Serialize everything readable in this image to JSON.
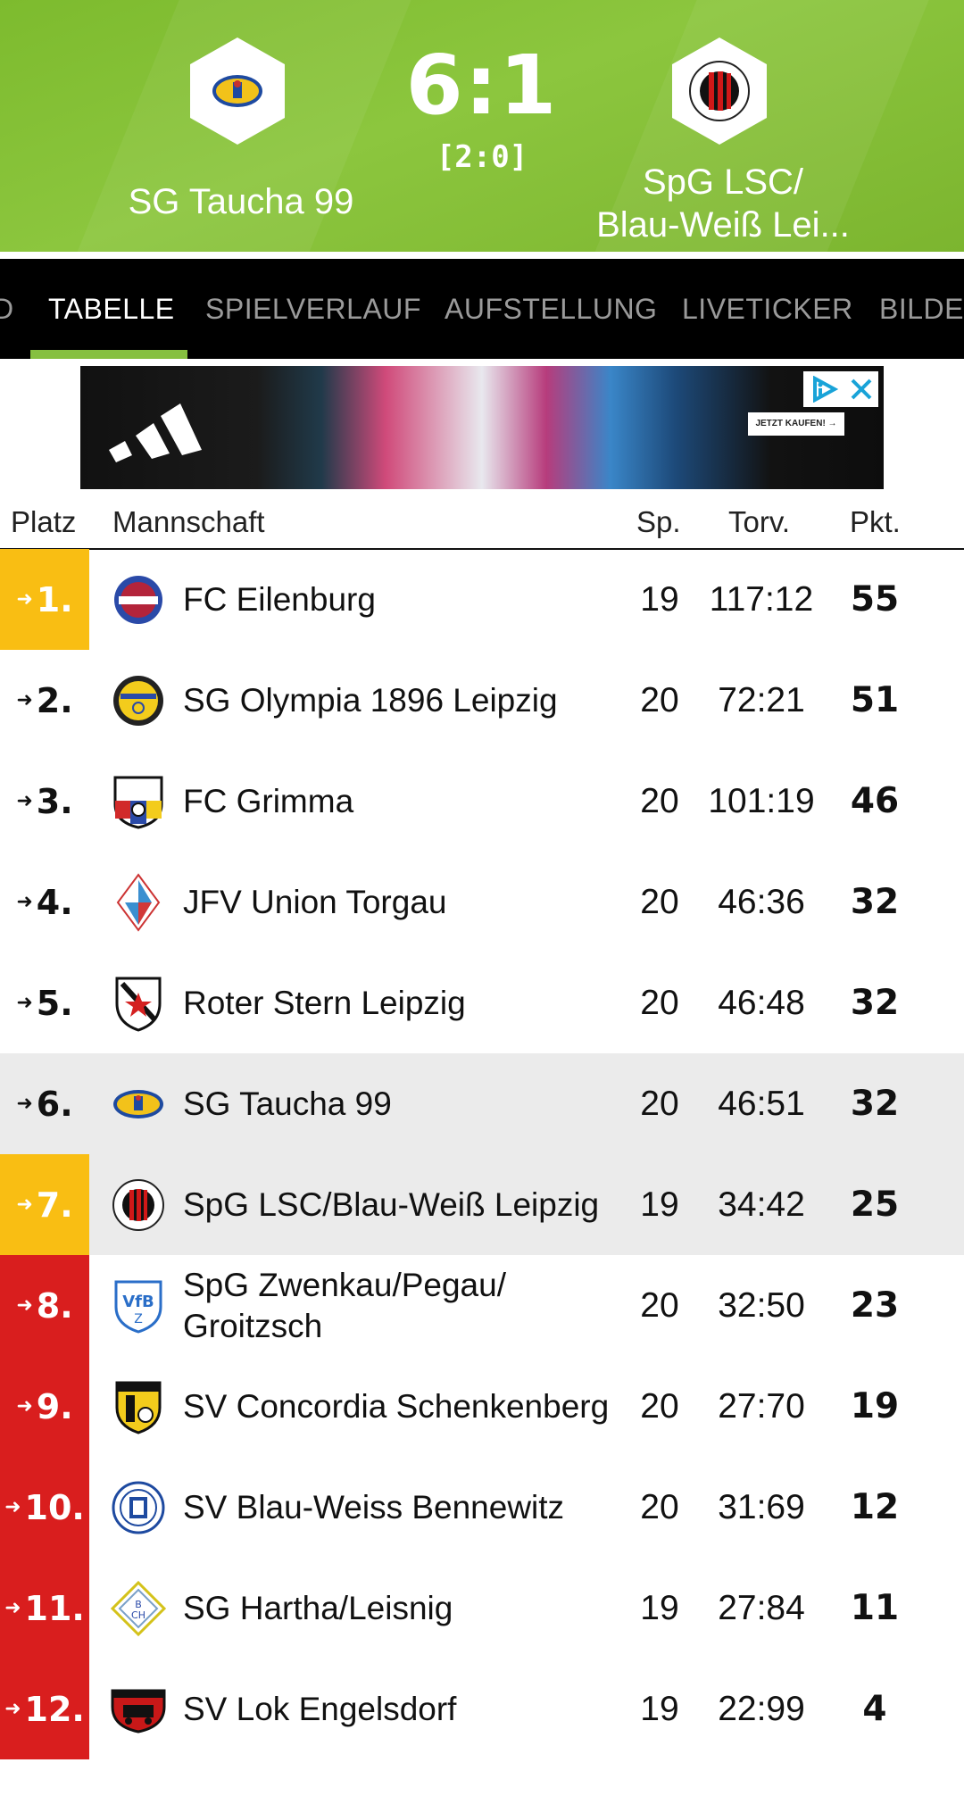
{
  "match": {
    "home_team": "SG Taucha 99",
    "away_team_line1": "SpG LSC/",
    "away_team_line2": "Blau-Weiß Lei...",
    "score": "6:1",
    "halftime": "[2:0]"
  },
  "tabs": [
    {
      "label": "D"
    },
    {
      "label": "TABELLE",
      "active": true
    },
    {
      "label": "SPIELVERLAUF"
    },
    {
      "label": "AUFSTELLUNG"
    },
    {
      "label": "LIVETICKER"
    },
    {
      "label": "BILDER"
    }
  ],
  "ad": {
    "cta": "JETZT KAUFEN! →",
    "choices_icon": "ad-choices-icon",
    "close_icon": "close-icon"
  },
  "table": {
    "headers": {
      "platz": "Platz",
      "mannschaft": "Mannschaft",
      "sp": "Sp.",
      "torv": "Torv.",
      "pkt": "Pkt."
    },
    "rows": [
      {
        "rank": "1.",
        "team": "FC Eilenburg",
        "sp": "19",
        "torv": "117:12",
        "pkt": "55",
        "zone": "yellow"
      },
      {
        "rank": "2.",
        "team": "SG Olympia 1896 Leipzig",
        "sp": "20",
        "torv": "72:21",
        "pkt": "51",
        "zone": "none"
      },
      {
        "rank": "3.",
        "team": "FC Grimma",
        "sp": "20",
        "torv": "101:19",
        "pkt": "46",
        "zone": "none"
      },
      {
        "rank": "4.",
        "team": "JFV Union Torgau",
        "sp": "20",
        "torv": "46:36",
        "pkt": "32",
        "zone": "none"
      },
      {
        "rank": "5.",
        "team": "Roter Stern Leipzig",
        "sp": "20",
        "torv": "46:48",
        "pkt": "32",
        "zone": "none"
      },
      {
        "rank": "6.",
        "team": "SG Taucha 99",
        "sp": "20",
        "torv": "46:51",
        "pkt": "32",
        "zone": "none",
        "highlight": true
      },
      {
        "rank": "7.",
        "team": "SpG LSC/Blau-Weiß Leipzig",
        "sp": "19",
        "torv": "34:42",
        "pkt": "25",
        "zone": "yellow",
        "highlight": true
      },
      {
        "rank": "8.",
        "team": "SpG Zwenkau/Pegau/ Groitzsch",
        "sp": "20",
        "torv": "32:50",
        "pkt": "23",
        "zone": "red"
      },
      {
        "rank": "9.",
        "team": "SV Concordia Schenkenberg",
        "sp": "20",
        "torv": "27:70",
        "pkt": "19",
        "zone": "red"
      },
      {
        "rank": "10.",
        "team": "SV Blau-Weiss Bennewitz",
        "sp": "20",
        "torv": "31:69",
        "pkt": "12",
        "zone": "red"
      },
      {
        "rank": "11.",
        "team": "SG Hartha/Leisnig",
        "sp": "19",
        "torv": "27:84",
        "pkt": "11",
        "zone": "red"
      },
      {
        "rank": "12.",
        "team": "SV Lok Engelsdorf",
        "sp": "19",
        "torv": "22:99",
        "pkt": "4",
        "zone": "red"
      }
    ]
  },
  "colors": {
    "header_green": "#8cc63e",
    "tab_bar": "#000000",
    "tab_accent": "#86c040",
    "promotion_yellow": "#f9be13",
    "relegation_red": "#d91e1e",
    "highlight_row": "#ebebeb"
  }
}
